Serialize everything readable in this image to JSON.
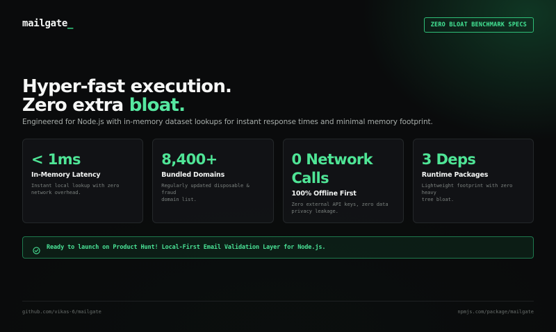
{
  "header": {
    "logo_text": "mailgate",
    "logo_cursor": "_",
    "badge_label": "ZERO BLOAT BENCHMARK SPECS"
  },
  "hero": {
    "line1": "Hyper-fast execution.",
    "line2_prefix": "Zero extra",
    "line2_accent": "bloat.",
    "subtitle": "Engineered for Node.js with in-memory dataset lookups for instant response times and minimal memory footprint."
  },
  "stats": [
    {
      "value": "< 1ms",
      "title": "In-Memory Latency",
      "desc_lines": [
        "Instant local lookup with zero",
        "network overhead."
      ]
    },
    {
      "value": "8,400+",
      "title": "Bundled Domains",
      "desc_lines": [
        "Regularly updated disposable & fraud",
        "domain list."
      ]
    },
    {
      "value_lines": [
        "0 Network",
        "Calls"
      ],
      "title": "100% Offline First",
      "desc_lines": [
        "Zero external API keys, zero data",
        "privacy leakage."
      ]
    },
    {
      "value": "3 Deps",
      "title": "Runtime Packages",
      "desc_lines": [
        "Lightweight footprint with zero heavy",
        "tree bloat."
      ]
    }
  ],
  "banner": {
    "icon": "check-circle-icon",
    "text": "Ready to launch on Product Hunt! Local-First Email Validation Layer for Node.js."
  },
  "footer": {
    "left_link": "github.com/vikas-6/mailgate",
    "right_link": "npmjs.com/package/mailgate"
  },
  "colors": {
    "accent": "#4fe596",
    "background": "#0a0b0c",
    "card_border": "#24282a",
    "muted_text": "#7d8380"
  }
}
